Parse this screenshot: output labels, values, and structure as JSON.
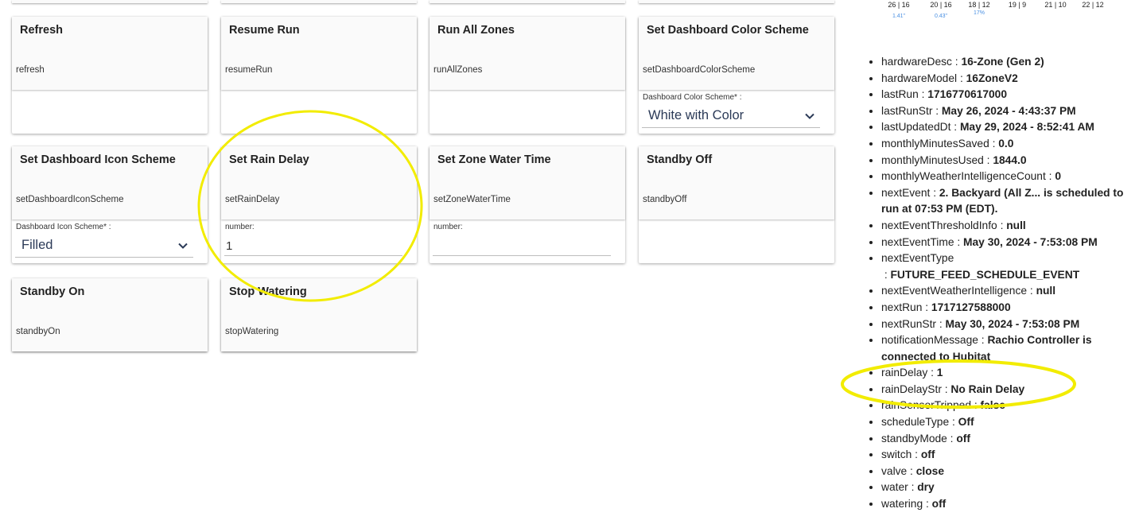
{
  "commands": [
    {
      "title": "Refresh",
      "cmd": "refresh"
    },
    {
      "title": "Resume Run",
      "cmd": "resumeRun"
    },
    {
      "title": "Run All Zones",
      "cmd": "runAllZones"
    },
    {
      "title": "Set Dashboard Color Scheme",
      "cmd": "setDashboardColorScheme",
      "param_label": "Dashboard Color Scheme* :",
      "param_value": "White with Color"
    },
    {
      "title": "Set Dashboard Icon Scheme",
      "cmd": "setDashboardIconScheme",
      "param_label": "Dashboard Icon Scheme* :",
      "param_value": "Filled"
    },
    {
      "title": "Set Rain Delay",
      "cmd": "setRainDelay",
      "param_label": "number:",
      "param_value": "1"
    },
    {
      "title": "Set Zone Water Time",
      "cmd": "setZoneWaterTime",
      "param_label": "number:",
      "param_value": ""
    },
    {
      "title": "Standby Off",
      "cmd": "standbyOff"
    },
    {
      "title": "Standby On",
      "cmd": "standbyOn"
    },
    {
      "title": "Stop Watering",
      "cmd": "stopWatering"
    }
  ],
  "weather": [
    {
      "temp": "26 | 16",
      "rain": "1.41\""
    },
    {
      "temp": "20 | 16",
      "rain": "0.43\""
    },
    {
      "temp": "18 | 12",
      "rain": "17%"
    },
    {
      "temp": "19 | 9",
      "rain": ""
    },
    {
      "temp": "21 | 10",
      "rain": ""
    },
    {
      "temp": "22 | 12",
      "rain": ""
    }
  ],
  "attributes": [
    {
      "key": "hardwareDesc",
      "value": "16-Zone (Gen 2)"
    },
    {
      "key": "hardwareModel",
      "value": "16ZoneV2"
    },
    {
      "key": "lastRun",
      "value": "1716770617000"
    },
    {
      "key": "lastRunStr",
      "value": "May 26, 2024 - 4:43:37 PM"
    },
    {
      "key": "lastUpdatedDt",
      "value": "May 29, 2024 - 8:52:41 AM"
    },
    {
      "key": "monthlyMinutesSaved",
      "value": "0.0"
    },
    {
      "key": "monthlyMinutesUsed",
      "value": "1844.0"
    },
    {
      "key": "monthlyWeatherIntelligenceCount",
      "value": "0"
    },
    {
      "key": "nextEvent",
      "value": "2. Backyard (All Z... is scheduled to run at 07:53 PM (EDT)."
    },
    {
      "key": "nextEventThresholdInfo",
      "value": "null"
    },
    {
      "key": "nextEventTime",
      "value": "May 30, 2024 - 7:53:08 PM"
    },
    {
      "key": "nextEventType",
      "value": "FUTURE_FEED_SCHEDULE_EVENT"
    },
    {
      "key": "nextEventWeatherIntelligence",
      "value": "null"
    },
    {
      "key": "nextRun",
      "value": "1717127588000"
    },
    {
      "key": "nextRunStr",
      "value": "May 30, 2024 - 7:53:08 PM"
    },
    {
      "key": "notificationMessage",
      "value": "Rachio Controller is connected to Hubitat"
    },
    {
      "key": "rainDelay",
      "value": "1"
    },
    {
      "key": "rainDelayStr",
      "value": "No Rain Delay"
    },
    {
      "key": "rainSensorTripped",
      "value": "false"
    },
    {
      "key": "scheduleType",
      "value": "Off"
    },
    {
      "key": "standbyMode",
      "value": "off"
    },
    {
      "key": "switch",
      "value": "off"
    },
    {
      "key": "valve",
      "value": "close"
    },
    {
      "key": "water",
      "value": "dry"
    },
    {
      "key": "watering",
      "value": "off"
    }
  ],
  "separator": " : ",
  "annotation_color": "#f2ec00"
}
